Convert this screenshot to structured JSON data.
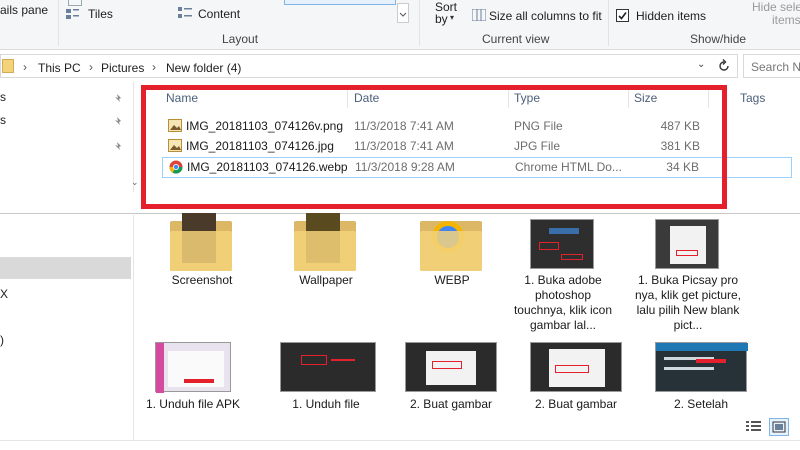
{
  "ribbon": {
    "details_pane_partial": "ails pane",
    "tiles": "Tiles",
    "content": "Content",
    "layout_group": "Layout",
    "sort": "Sort",
    "by": "by",
    "size_all_columns": "Size all columns to fit",
    "current_view_group": "Current view",
    "hidden_items": "Hidden items",
    "hide_selected_line1": "Hide selec",
    "hide_selected_line2": "items",
    "show_hide_group": "Show/hide"
  },
  "address": {
    "crumbs": [
      "This PC",
      "Pictures",
      "New folder (4)"
    ],
    "search_placeholder": "Search N"
  },
  "nav_pane": {
    "items_top": [
      "s",
      "s"
    ],
    "items_bottom": [
      "X",
      ")"
    ]
  },
  "columns": [
    "Name",
    "Date",
    "Type",
    "Size",
    "Tags"
  ],
  "files": [
    {
      "name": "IMG_20181103_074126v.png",
      "date": "11/3/2018 7:41 AM",
      "type": "PNG File",
      "size": "487 KB"
    },
    {
      "name": "IMG_20181103_074126.jpg",
      "date": "11/3/2018 7:41 AM",
      "type": "JPG File",
      "size": "381 KB"
    },
    {
      "name": "IMG_20181103_074126.webp",
      "date": "11/3/2018 9:28 AM",
      "type": "Chrome HTML Do...",
      "size": "34 KB"
    }
  ],
  "tiles_row1": [
    "Screenshot",
    "Wallpaper",
    "WEBP",
    "1. Buka adobe photoshop touchnya, klik icon gambar lal...",
    "1. Buka Picsay pro nya, klik get picture, lalu pilih New blank pict..."
  ],
  "tiles_row2": [
    "1. Unduh file APK",
    "1. Unduh file",
    "2. Buat gambar",
    "2. Buat gambar",
    "2. Setelah"
  ],
  "colors": {
    "highlight_box": "#e3202b",
    "selection_border": "#99d1ff",
    "folder": "#f3d27a"
  }
}
